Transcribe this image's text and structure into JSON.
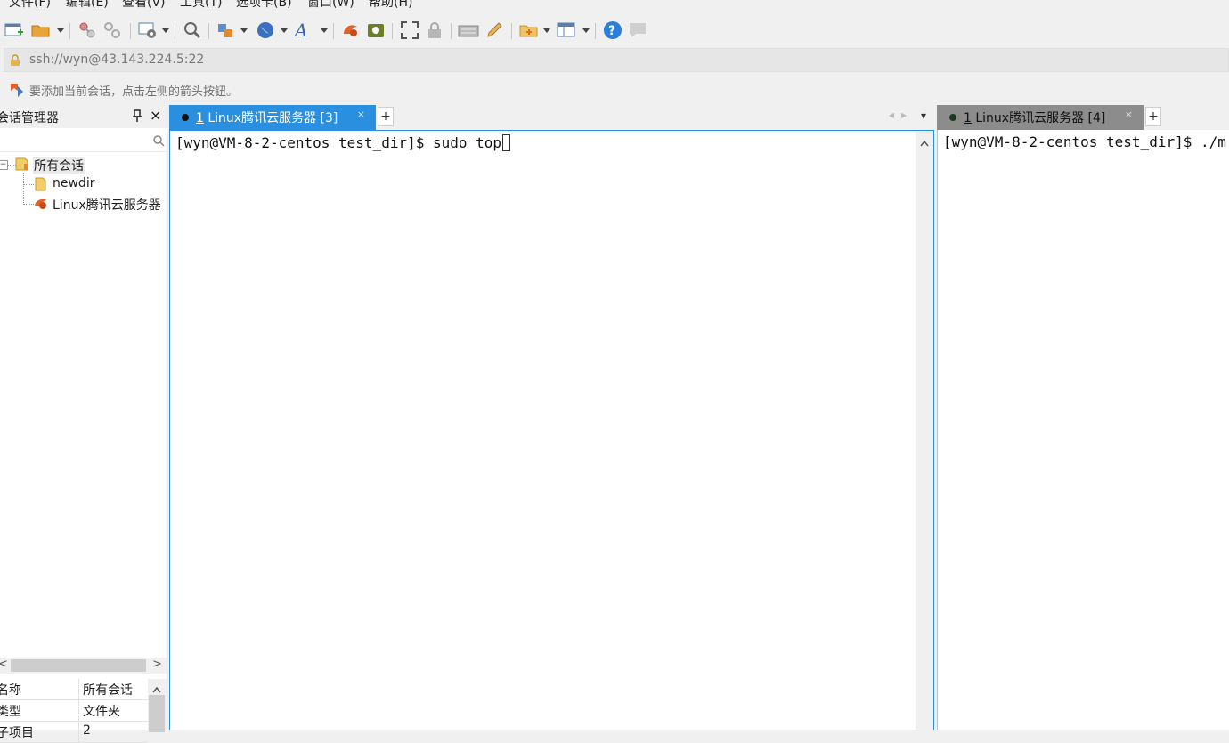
{
  "menu": [
    "文件(F)",
    "编辑(E)",
    "查看(V)",
    "工具(T)",
    "选项卡(B)",
    "窗口(W)",
    "帮助(H)"
  ],
  "address": "ssh://wyn@43.143.224.5:22",
  "hint": "要添加当前会话，点击左侧的箭头按钮。",
  "session_panel": {
    "title": "会话管理器",
    "pin": "ᵖ",
    "close": "×",
    "tree": {
      "root": "所有会话",
      "children": [
        "newdir",
        "Linux腾讯云服务器"
      ]
    },
    "scroll_left": "<",
    "scroll_right": ">",
    "props": [
      {
        "key": "名称",
        "value": "所有会话"
      },
      {
        "key": "类型",
        "value": "文件夹"
      },
      {
        "key": "子项目",
        "value": "2"
      }
    ]
  },
  "tabs": {
    "left": {
      "number": "1",
      "label": " Linux腾讯云服务器 [3]",
      "close": "×",
      "add": "+"
    },
    "right": {
      "number": "1",
      "label": " Linux腾讯云服务器 [4]",
      "close": "×",
      "add": "+"
    },
    "nav_prev": "◂",
    "nav_next": "▸",
    "nav_menu": "▾"
  },
  "terminal": {
    "left_line": "[wyn@VM-8-2-centos test_dir]$ sudo top",
    "right_line": "[wyn@VM-8-2-centos test_dir]$ ./m"
  },
  "colors": {
    "accent": "#2b8fe0",
    "inactive_tab": "#8c8c8c"
  }
}
